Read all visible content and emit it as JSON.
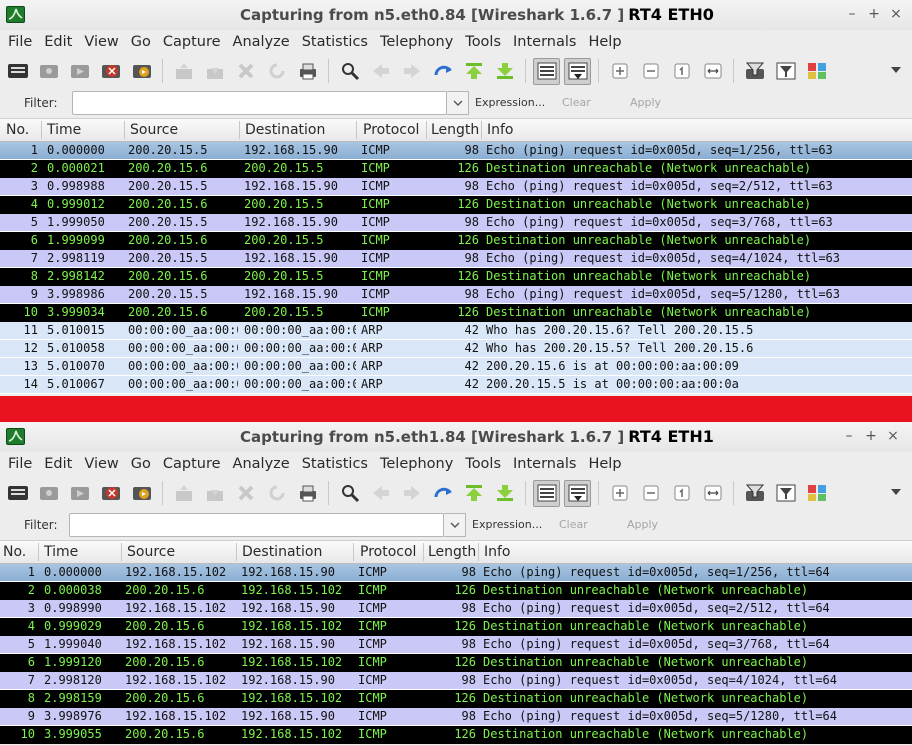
{
  "menus": [
    "File",
    "Edit",
    "View",
    "Go",
    "Capture",
    "Analyze",
    "Statistics",
    "Telephony",
    "Tools",
    "Internals",
    "Help"
  ],
  "filter": {
    "label": "Filter:",
    "value": "",
    "expression": "Expression...",
    "clear": "Clear",
    "apply": "Apply"
  },
  "columns": [
    "No.",
    "Time",
    "Source",
    "Destination",
    "Protocol",
    "Length",
    "Info"
  ],
  "row_colors": {
    "request": "#c9c8f6",
    "unreachable_bg": "#000000",
    "unreachable_fg": "#7ef24d",
    "arp": "#d9e7f9",
    "selected": "#8aaed2",
    "separator": "#e8131e"
  },
  "window1": {
    "title": "Capturing from n5.eth0.84    [Wireshark 1.6.7 ]",
    "tag": "RT4 ETH0",
    "packets": [
      {
        "no": "1",
        "time": "0.000000",
        "source": "200.20.15.5",
        "destination": "192.168.15.90",
        "protocol": "ICMP",
        "length": "98",
        "info": "Echo (ping) request  id=0x005d, seq=1/256, ttl=63",
        "kind": "selected"
      },
      {
        "no": "2",
        "time": "0.000021",
        "source": "200.20.15.6",
        "destination": "200.20.15.5",
        "protocol": "ICMP",
        "length": "126",
        "info": "Destination unreachable (Network unreachable)",
        "kind": "err"
      },
      {
        "no": "3",
        "time": "0.998988",
        "source": "200.20.15.5",
        "destination": "192.168.15.90",
        "protocol": "ICMP",
        "length": "98",
        "info": "Echo (ping) request  id=0x005d, seq=2/512, ttl=63",
        "kind": "req"
      },
      {
        "no": "4",
        "time": "0.999012",
        "source": "200.20.15.6",
        "destination": "200.20.15.5",
        "protocol": "ICMP",
        "length": "126",
        "info": "Destination unreachable (Network unreachable)",
        "kind": "err"
      },
      {
        "no": "5",
        "time": "1.999050",
        "source": "200.20.15.5",
        "destination": "192.168.15.90",
        "protocol": "ICMP",
        "length": "98",
        "info": "Echo (ping) request  id=0x005d, seq=3/768, ttl=63",
        "kind": "req"
      },
      {
        "no": "6",
        "time": "1.999099",
        "source": "200.20.15.6",
        "destination": "200.20.15.5",
        "protocol": "ICMP",
        "length": "126",
        "info": "Destination unreachable (Network unreachable)",
        "kind": "err"
      },
      {
        "no": "7",
        "time": "2.998119",
        "source": "200.20.15.5",
        "destination": "192.168.15.90",
        "protocol": "ICMP",
        "length": "98",
        "info": "Echo (ping) request  id=0x005d, seq=4/1024, ttl=63",
        "kind": "req"
      },
      {
        "no": "8",
        "time": "2.998142",
        "source": "200.20.15.6",
        "destination": "200.20.15.5",
        "protocol": "ICMP",
        "length": "126",
        "info": "Destination unreachable (Network unreachable)",
        "kind": "err"
      },
      {
        "no": "9",
        "time": "3.998986",
        "source": "200.20.15.5",
        "destination": "192.168.15.90",
        "protocol": "ICMP",
        "length": "98",
        "info": "Echo (ping) request  id=0x005d, seq=5/1280, ttl=63",
        "kind": "req"
      },
      {
        "no": "10",
        "time": "3.999034",
        "source": "200.20.15.6",
        "destination": "200.20.15.5",
        "protocol": "ICMP",
        "length": "126",
        "info": "Destination unreachable (Network unreachable)",
        "kind": "err"
      },
      {
        "no": "11",
        "time": "5.010015",
        "source": "00:00:00_aa:00:0",
        "destination": "00:00:00_aa:00:0",
        "protocol": "ARP",
        "length": "42",
        "info": "Who has 200.20.15.6?  Tell 200.20.15.5",
        "kind": "arp"
      },
      {
        "no": "12",
        "time": "5.010058",
        "source": "00:00:00_aa:00:0",
        "destination": "00:00:00_aa:00:0",
        "protocol": "ARP",
        "length": "42",
        "info": "Who has 200.20.15.5?  Tell 200.20.15.6",
        "kind": "arp"
      },
      {
        "no": "13",
        "time": "5.010070",
        "source": "00:00:00_aa:00:0",
        "destination": "00:00:00_aa:00:0",
        "protocol": "ARP",
        "length": "42",
        "info": "200.20.15.6 is at 00:00:00:aa:00:09",
        "kind": "arp"
      },
      {
        "no": "14",
        "time": "5.010067",
        "source": "00:00:00_aa:00:0",
        "destination": "00:00:00_aa:00:0",
        "protocol": "ARP",
        "length": "42",
        "info": "200.20.15.5 is at 00:00:00:aa:00:0a",
        "kind": "arp"
      }
    ]
  },
  "window2": {
    "title": "Capturing from n5.eth1.84    [Wireshark 1.6.7 ]",
    "tag": "RT4 ETH1",
    "packets": [
      {
        "no": "1",
        "time": "0.000000",
        "source": "192.168.15.102",
        "destination": "192.168.15.90",
        "protocol": "ICMP",
        "length": "98",
        "info": "Echo (ping) request  id=0x005d, seq=1/256, ttl=64",
        "kind": "selected"
      },
      {
        "no": "2",
        "time": "0.000038",
        "source": "200.20.15.6",
        "destination": "192.168.15.102",
        "protocol": "ICMP",
        "length": "126",
        "info": "Destination unreachable (Network unreachable)",
        "kind": "err"
      },
      {
        "no": "3",
        "time": "0.998990",
        "source": "192.168.15.102",
        "destination": "192.168.15.90",
        "protocol": "ICMP",
        "length": "98",
        "info": "Echo (ping) request  id=0x005d, seq=2/512, ttl=64",
        "kind": "req"
      },
      {
        "no": "4",
        "time": "0.999029",
        "source": "200.20.15.6",
        "destination": "192.168.15.102",
        "protocol": "ICMP",
        "length": "126",
        "info": "Destination unreachable (Network unreachable)",
        "kind": "err"
      },
      {
        "no": "5",
        "time": "1.999040",
        "source": "192.168.15.102",
        "destination": "192.168.15.90",
        "protocol": "ICMP",
        "length": "98",
        "info": "Echo (ping) request  id=0x005d, seq=3/768, ttl=64",
        "kind": "req"
      },
      {
        "no": "6",
        "time": "1.999120",
        "source": "200.20.15.6",
        "destination": "192.168.15.102",
        "protocol": "ICMP",
        "length": "126",
        "info": "Destination unreachable (Network unreachable)",
        "kind": "err"
      },
      {
        "no": "7",
        "time": "2.998120",
        "source": "192.168.15.102",
        "destination": "192.168.15.90",
        "protocol": "ICMP",
        "length": "98",
        "info": "Echo (ping) request  id=0x005d, seq=4/1024, ttl=64",
        "kind": "req"
      },
      {
        "no": "8",
        "time": "2.998159",
        "source": "200.20.15.6",
        "destination": "192.168.15.102",
        "protocol": "ICMP",
        "length": "126",
        "info": "Destination unreachable (Network unreachable)",
        "kind": "err"
      },
      {
        "no": "9",
        "time": "3.998976",
        "source": "192.168.15.102",
        "destination": "192.168.15.90",
        "protocol": "ICMP",
        "length": "98",
        "info": "Echo (ping) request  id=0x005d, seq=5/1280, ttl=64",
        "kind": "req"
      },
      {
        "no": "10",
        "time": "3.999055",
        "source": "200.20.15.6",
        "destination": "192.168.15.102",
        "protocol": "ICMP",
        "length": "126",
        "info": "Destination unreachable (Network unreachable)",
        "kind": "err"
      }
    ]
  }
}
